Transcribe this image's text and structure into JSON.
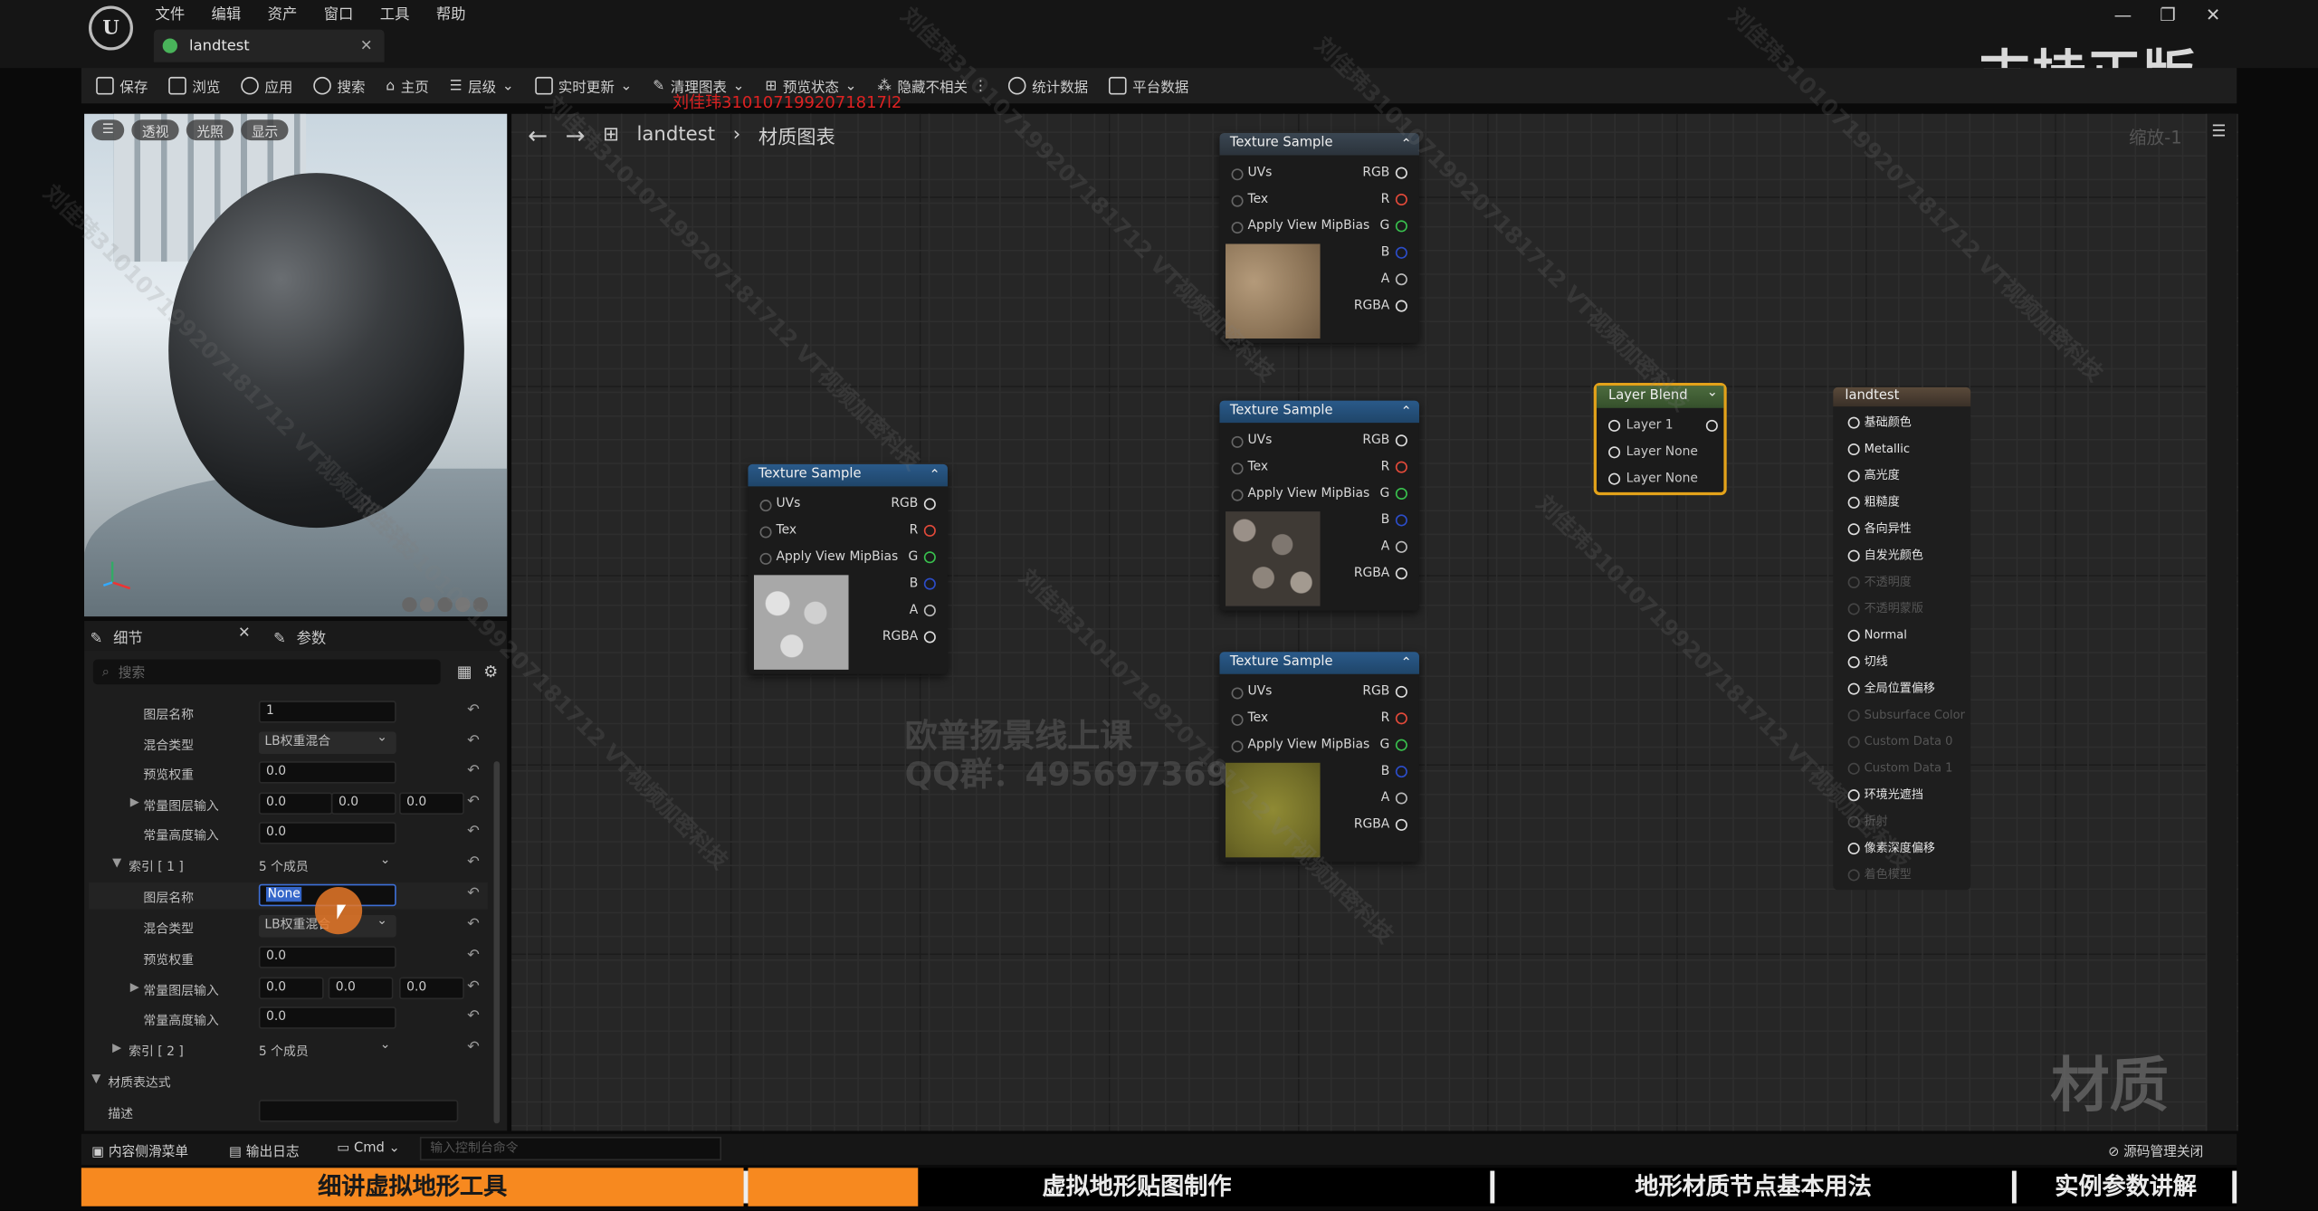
{
  "app": {
    "logo": "U",
    "tab_title": "landtest",
    "support_text": "支持正版"
  },
  "menu": [
    "文件",
    "编辑",
    "资产",
    "窗口",
    "工具",
    "帮助"
  ],
  "toolbar": [
    "保存",
    "浏览",
    "应用",
    "搜索",
    "主页",
    "层级",
    "实时更新",
    "清理图表",
    "预览状态",
    "隐藏不相关",
    "统计数据",
    "平台数据"
  ],
  "viewport": {
    "buttons": [
      "透视",
      "光照",
      "显示"
    ]
  },
  "breadcrumb": {
    "root": "landtest",
    "child": "材质图表"
  },
  "zoom_label": "缩放-1",
  "details": {
    "tab_details": "细节",
    "tab_params": "参数",
    "search_placeholder": "搜索",
    "rows": [
      {
        "label": "图层名称",
        "value": "1"
      },
      {
        "label": "混合类型",
        "value": "LB权重混合"
      },
      {
        "label": "预览权重",
        "value": "0.0"
      },
      {
        "label": "常量图层输入",
        "values": [
          "0.0",
          "0.0",
          "0.0"
        ]
      },
      {
        "label": "常量高度输入",
        "value": "0.0"
      },
      {
        "label": "索引 [ 1 ]",
        "value": "5 个成员"
      },
      {
        "label": "图层名称",
        "value": "None"
      },
      {
        "label": "混合类型",
        "value": "LB权重混合"
      },
      {
        "label": "预览权重",
        "value": "0.0"
      },
      {
        "label": "常量图层输入",
        "values": [
          "0.0",
          "0.0",
          "0.0"
        ]
      },
      {
        "label": "常量高度输入",
        "value": "0.0"
      },
      {
        "label": "索引 [ 2 ]",
        "value": "5 个成员"
      },
      {
        "label": "材质表达式"
      },
      {
        "label": "描述"
      }
    ]
  },
  "texture_node": {
    "title": "Texture Sample",
    "inputs": [
      "UVs",
      "Tex",
      "Apply View MipBias"
    ],
    "outputs": [
      "RGB",
      "R",
      "G",
      "B",
      "A",
      "RGBA"
    ]
  },
  "layer_blend": {
    "title": "Layer Blend",
    "pins": [
      "Layer 1",
      "Layer None",
      "Layer None"
    ]
  },
  "material_node": {
    "title": "landtest",
    "pins": [
      "基础颜色",
      "Metallic",
      "高光度",
      "粗糙度",
      "各向异性",
      "自发光颜色",
      "不透明度",
      "不透明蒙版",
      "Normal",
      "切线",
      "全局位置偏移",
      "Subsurface Color",
      "Custom Data 0",
      "Custom Data 1",
      "环境光遮挡",
      "折射",
      "像素深度偏移",
      "着色模型"
    ]
  },
  "statusbar": {
    "content_drawer": "内容侧滑菜单",
    "output_log": "输出日志",
    "cmd": "Cmd",
    "cmd_placeholder": "输入控制台命令",
    "source_control": "源码管理关闭"
  },
  "banner": [
    "细讲虚拟地形工具",
    "虚拟地形贴图制作",
    "地形材质节点基本用法",
    "实例参数讲解"
  ],
  "watermarks": {
    "red": "刘佳玮3101071992071817l2",
    "center_line1": "欧普扬景线上课",
    "center_line2": "QQ群：495697369",
    "corner": "材质",
    "diag": "刘佳玮310107199207181712 VT视频加密科技"
  },
  "colors": {
    "accent_orange": "#f7891f",
    "selection_blue": "#3566c9",
    "node_header_blue": "#2a5a8a",
    "layer_blend_border": "#e3a21a"
  }
}
